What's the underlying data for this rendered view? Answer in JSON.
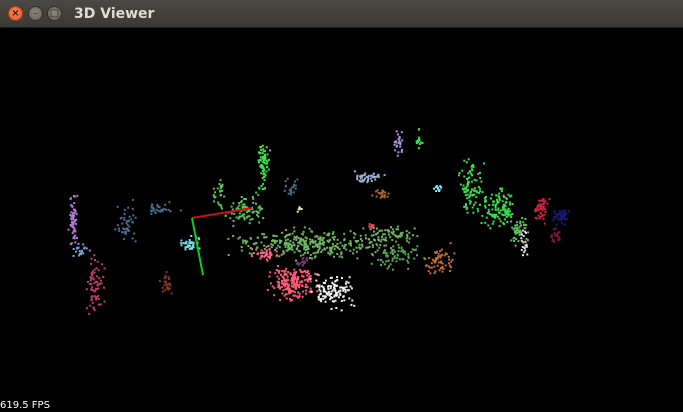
{
  "window": {
    "title": "3D Viewer",
    "close_glyph": "×",
    "minimize_glyph": "–",
    "maximize_glyph": "□"
  },
  "viewer": {
    "fps_text": "619.5 FPS",
    "background": "#000000"
  },
  "colors": {
    "axis_x": "#cc1111",
    "axis_y": "#11cc11"
  }
}
